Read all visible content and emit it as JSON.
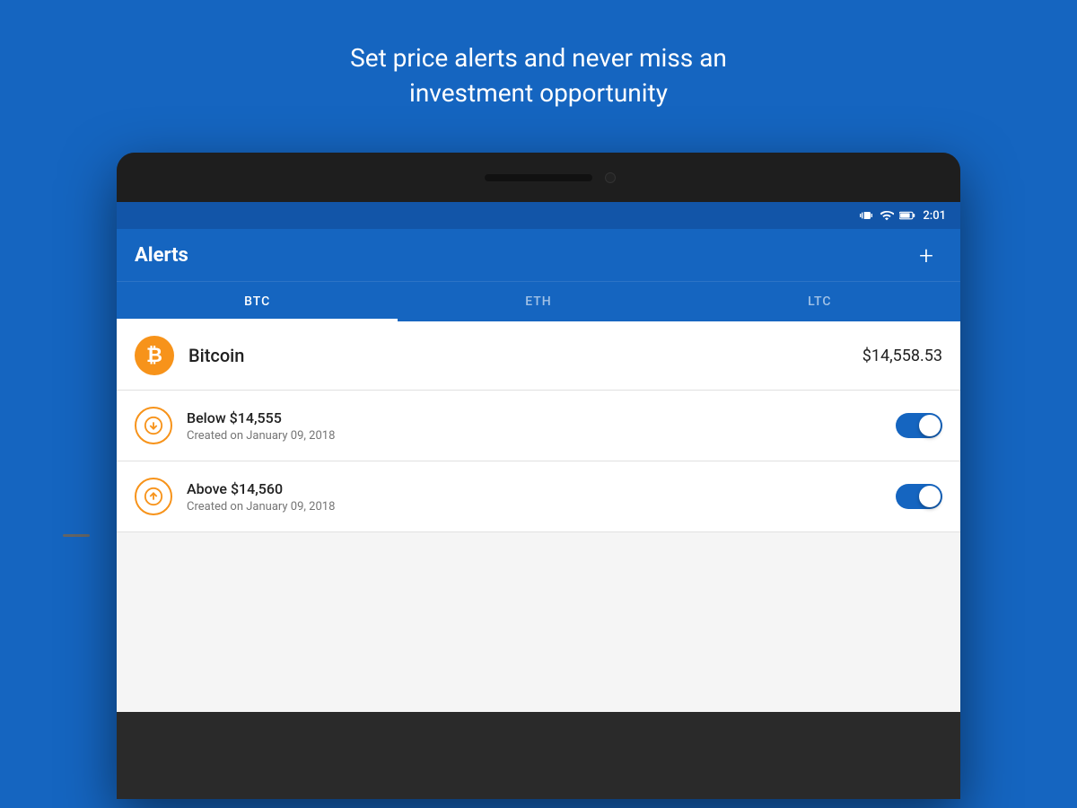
{
  "page": {
    "background_color": "#1565C0",
    "headline_line1": "Set price alerts and never miss an",
    "headline_line2": "investment opportunity"
  },
  "status_bar": {
    "time": "2:01",
    "icons": [
      "vibrate",
      "wifi",
      "battery"
    ]
  },
  "app_bar": {
    "title": "Alerts",
    "add_button_label": "+"
  },
  "tabs": [
    {
      "label": "BTC",
      "active": true
    },
    {
      "label": "ETH",
      "active": false
    },
    {
      "label": "LTC",
      "active": false
    }
  ],
  "bitcoin_row": {
    "icon_letter": "₿",
    "name": "Bitcoin",
    "price": "$14,558.53"
  },
  "alerts": [
    {
      "type": "below",
      "label": "Below $14,555",
      "date": "Created on January 09, 2018",
      "enabled": true
    },
    {
      "type": "above",
      "label": "Above $14,560",
      "date": "Created on January 09, 2018",
      "enabled": true
    }
  ]
}
